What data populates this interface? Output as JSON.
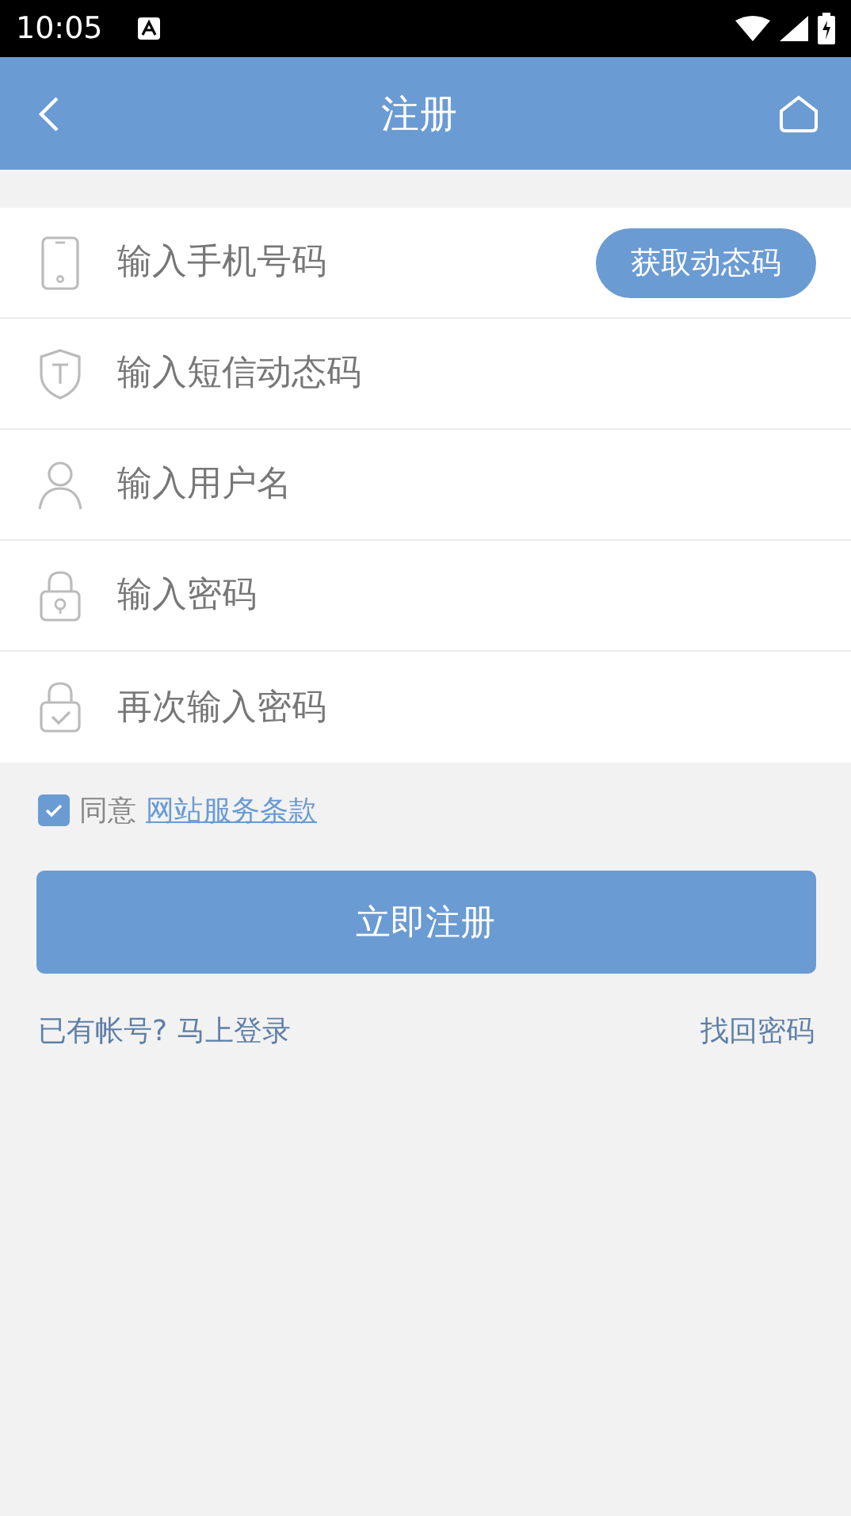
{
  "status_bar": {
    "time": "10:05"
  },
  "header": {
    "title": "注册"
  },
  "fields": [
    {
      "kind": "phone",
      "placeholder": "输入手机号码",
      "action": "获取动态码"
    },
    {
      "kind": "code",
      "placeholder": "输入短信动态码"
    },
    {
      "kind": "user",
      "placeholder": "输入用户名"
    },
    {
      "kind": "password",
      "placeholder": "输入密码"
    },
    {
      "kind": "confirm",
      "placeholder": "再次输入密码"
    }
  ],
  "agreement": {
    "checked": true,
    "label": "同意",
    "link": "网站服务条款"
  },
  "submit": "立即注册",
  "links": {
    "login": "已有帐号? 马上登录",
    "recover": "找回密码"
  }
}
